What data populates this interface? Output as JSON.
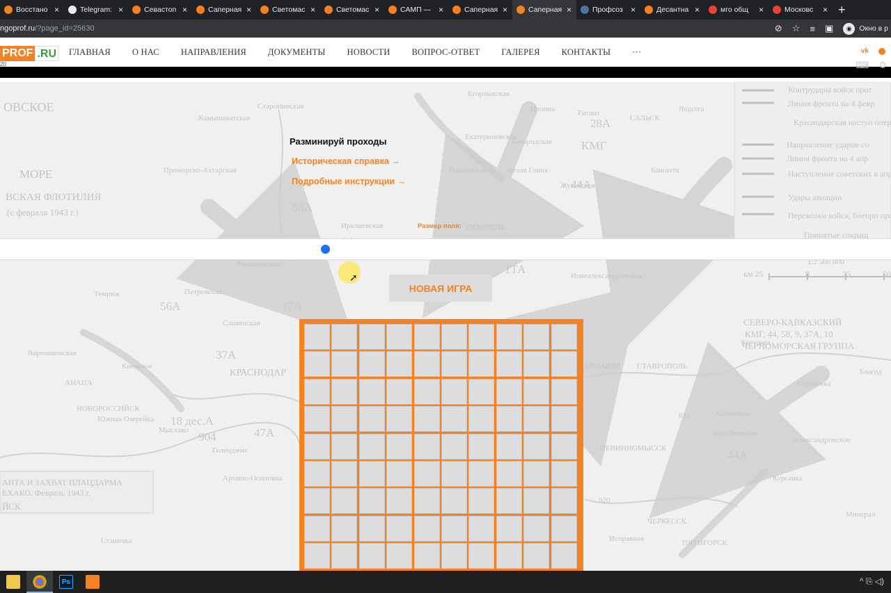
{
  "browser": {
    "tabs": [
      {
        "title": "Восстано",
        "fav": "#f58220"
      },
      {
        "title": "Telegram:",
        "fav": "#e8eaed"
      },
      {
        "title": "Севастоп",
        "fav": "#f58220"
      },
      {
        "title": "Саперная",
        "fav": "#f58220"
      },
      {
        "title": "Светомас",
        "fav": "#f58220"
      },
      {
        "title": "Светомас",
        "fav": "#f58220"
      },
      {
        "title": "САМП —",
        "fav": "#f58220"
      },
      {
        "title": "Саперная",
        "fav": "#f58220"
      },
      {
        "title": "Саперная",
        "fav": "#f58220",
        "active": true
      },
      {
        "title": "Профсоз",
        "fav": "#4a76a8"
      },
      {
        "title": "Десантна",
        "fav": "#f58220"
      },
      {
        "title": "мго общ",
        "fav": "#ea4335"
      },
      {
        "title": "Московс",
        "fav": "#ea4335"
      }
    ],
    "close_glyph": "×",
    "newtab_glyph": "+",
    "url_host": "ngoprof.ru",
    "url_path": "/?page_id=25630",
    "profile_label": "Окно в р"
  },
  "site": {
    "logo_a": "PROF",
    "logo_b": ".RU",
    "logo_sub": "20",
    "nav": [
      "ГЛАВНАЯ",
      "О НАС",
      "НАПРАВЛЕНИЯ",
      "ДОКУМЕНТЫ",
      "НОВОСТИ",
      "ВОПРОС-ОТВЕТ",
      "ГАЛЕРЕЯ",
      "КОНТАКТЫ",
      "···"
    ],
    "vk": "vk"
  },
  "game": {
    "title": "Разминируй проходы",
    "link_history": "Историческая справка →",
    "link_instructions": "Подробные инструкции →",
    "size_label": "Размер поля:",
    "new_game": "НОВАЯ ИГРА",
    "rows_visible": 9,
    "cols": 10
  },
  "map_labels": [
    "ОВСКОЕ",
    "МОРЕ",
    "ВСКАЯ ФЛОТИЛИЯ",
    "(с февраля 1943 г.)",
    "Староминская",
    "Камышеватская",
    "Приморско-Ахтарская",
    "Ирклиевская",
    "ТИХОРЕЦК",
    "Тимашевская",
    "Новоалександровская",
    "Темрюк",
    "Славянская",
    "Петровская",
    "Варениковская",
    "Киевское",
    "АНАПА",
    "НОВОРОССИЙСК",
    "Геленджик",
    "Архипо-Осиповка",
    "КРАСНОДАР",
    "АРМАВИР",
    "СТАВРОПОЛЬ",
    "НЕВИННОМЫССК",
    "ЧЕРКЕССК",
    "ПЯТИГОРСК",
    "Егорлыкская",
    "Целина",
    "Гигант",
    "САЛЬСК",
    "Ящалта",
    "Екатериновская",
    "Богородская",
    "Павловская",
    "Белая Глина",
    "Башанта",
    "Жуковское",
    "Кугульта",
    "Сергиевка",
    "Благод",
    "Курсавка",
    "Александровское",
    "Минерал",
    "Контрудары войск прот",
    "Линия фронта на 4 февр",
    "Краснодарская наступ операция",
    "Направление ударов со",
    "Линия фронта на 4 апр",
    "Наступление советских в апреле-мае",
    "Удары авиации",
    "Переволки войск, боепри продовольствия",
    "Принятые сокращ",
    "СЕВЕРО-КАВКАЗСКИЙ",
    "КМГ, 44, 58, 9, 37А, 10",
    "ЧЕРНОМОРСКАЯ ГРУППА",
    "АНТА И ЗАХВАТ ПЛАЦДАРМА",
    "ЕХАКО. Февраль 1943 г.",
    "ЙСК",
    "Станичка",
    "Южная Озерейка",
    "Мысхако",
    "1:2 500 000",
    "км 25",
    "0",
    "25",
    "50",
    "Исправная",
    "920",
    "831",
    "Спицевка",
    "Кочубеевское"
  ],
  "map_numbers": [
    "28А",
    "44А",
    "58А",
    "9А",
    "1ТА",
    "17А",
    "56А",
    "37А",
    "47А",
    "18 дес.А",
    "КМГ",
    "44А",
    "904"
  ],
  "taskbar": {
    "tray": "^ ⎘ ◁)"
  }
}
